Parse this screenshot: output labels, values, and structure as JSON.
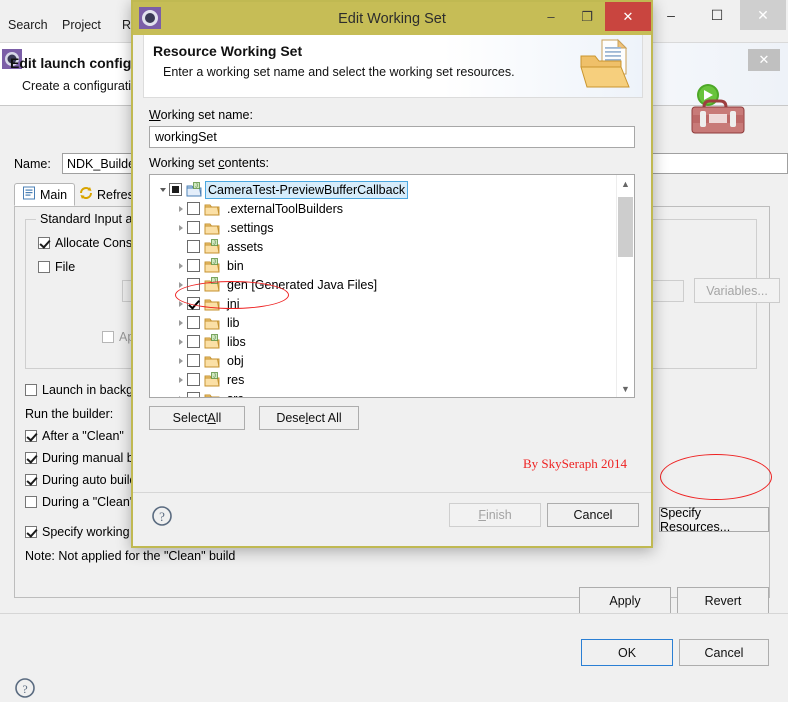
{
  "background": {
    "menu": [
      "Search",
      "Project",
      "Run"
    ],
    "window_buttons": [
      "minimize",
      "maximize",
      "close"
    ],
    "dialog": {
      "title": "Edit launch configuration properties",
      "subtitle": "Create a configuration that will run a program",
      "close_label": "✕",
      "name_label": "Name:",
      "name_value": "NDK_Builder",
      "tabs": [
        {
          "label": "Main",
          "icon": "document-icon",
          "active": true
        },
        {
          "label": "Refresh",
          "icon": "refresh-icon",
          "active": false
        }
      ],
      "group_title": "Standard Input and Output",
      "allocate_console": {
        "label": "Allocate Console (necessary for input)",
        "checked": true
      },
      "file": {
        "label": "File",
        "checked": false,
        "value": ""
      },
      "variables_label": "Variables...",
      "append": {
        "label": "Append",
        "checked": false
      },
      "launch_background": {
        "label": "Launch in background",
        "checked": false
      },
      "run_builder_label": "Run the builder:",
      "builder_options": [
        {
          "label": "After a \"Clean\"",
          "checked": true
        },
        {
          "label": "During manual builds",
          "checked": true
        },
        {
          "label": "During auto builds",
          "checked": true
        },
        {
          "label": "During a \"Clean\"",
          "checked": false
        }
      ],
      "specify_working_set": {
        "label": "Specify working set of relevant resources",
        "checked": true
      },
      "specify_resources_label": "Specify Resources...",
      "note": "Note: Not applied for the \"Clean\" build",
      "apply_label": "Apply",
      "revert_label": "Revert",
      "ok_label": "OK",
      "cancel_label": "Cancel"
    }
  },
  "dialog": {
    "title": "Edit Working Set",
    "window_buttons": {
      "minimize": "–",
      "maximize": "❐",
      "close": "✕"
    },
    "header": {
      "title": "Resource Working Set",
      "subtitle": "Enter a working set name and select the working set resources."
    },
    "working_set_name_label": "Working set name:",
    "working_set_name_value": "workingSet",
    "working_set_contents_label": "Working set contents:",
    "tree": [
      {
        "label": "CameraTest-PreviewBufferCallback",
        "depth": 0,
        "state": "partial",
        "expanded": true,
        "selected": true,
        "has_twisty": true,
        "icon": "project-folder-icon"
      },
      {
        "label": ".externalToolBuilders",
        "depth": 1,
        "state": "unchecked",
        "expanded": false,
        "selected": false,
        "has_twisty": true,
        "icon": "folder-icon"
      },
      {
        "label": ".settings",
        "depth": 1,
        "state": "unchecked",
        "expanded": false,
        "selected": false,
        "has_twisty": true,
        "icon": "folder-icon"
      },
      {
        "label": "assets",
        "depth": 1,
        "state": "unchecked",
        "expanded": false,
        "selected": false,
        "has_twisty": false,
        "icon": "source-folder-icon"
      },
      {
        "label": "bin",
        "depth": 1,
        "state": "unchecked",
        "expanded": false,
        "selected": false,
        "has_twisty": true,
        "icon": "source-folder-icon"
      },
      {
        "label": "gen [Generated Java Files]",
        "depth": 1,
        "state": "unchecked",
        "expanded": false,
        "selected": false,
        "has_twisty": true,
        "icon": "source-folder-icon"
      },
      {
        "label": "jni",
        "depth": 1,
        "state": "checked",
        "expanded": false,
        "selected": false,
        "has_twisty": true,
        "icon": "folder-icon"
      },
      {
        "label": "lib",
        "depth": 1,
        "state": "unchecked",
        "expanded": false,
        "selected": false,
        "has_twisty": true,
        "icon": "folder-icon"
      },
      {
        "label": "libs",
        "depth": 1,
        "state": "unchecked",
        "expanded": false,
        "selected": false,
        "has_twisty": true,
        "icon": "source-folder-icon"
      },
      {
        "label": "obj",
        "depth": 1,
        "state": "unchecked",
        "expanded": false,
        "selected": false,
        "has_twisty": true,
        "icon": "folder-icon"
      },
      {
        "label": "res",
        "depth": 1,
        "state": "unchecked",
        "expanded": false,
        "selected": false,
        "has_twisty": true,
        "icon": "source-folder-icon"
      },
      {
        "label": "src",
        "depth": 1,
        "state": "unchecked",
        "expanded": false,
        "selected": false,
        "has_twisty": true,
        "icon": "folder-icon"
      }
    ],
    "select_all_label": "Select All",
    "deselect_all_label": "Deselect All",
    "credit": "By SkySeraph 2014",
    "finish_label": "Finish",
    "cancel_label": "Cancel"
  },
  "colors": {
    "title_bar": "#c6bd56",
    "close_button": "#c9453f",
    "annotation": "#ee2222",
    "selection": "#d6ecfb"
  }
}
